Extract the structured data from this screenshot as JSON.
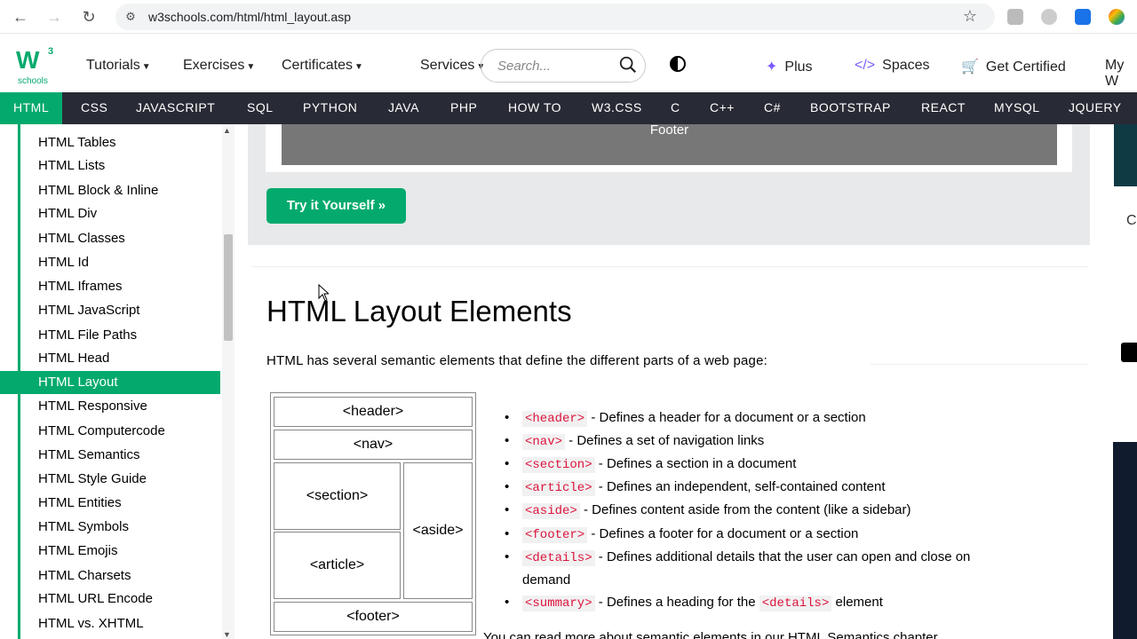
{
  "browser": {
    "url": "w3schools.com/html/html_layout.asp"
  },
  "topnav": {
    "logo_sup": "3",
    "logo_text": "schools",
    "menus": [
      "Tutorials",
      "Exercises",
      "Certificates",
      "Services"
    ],
    "search_placeholder": "Search...",
    "plus": "Plus",
    "spaces": "Spaces",
    "get_certified": "Get Certified",
    "my": "My W"
  },
  "subjects": [
    "HTML",
    "CSS",
    "JAVASCRIPT",
    "SQL",
    "PYTHON",
    "JAVA",
    "PHP",
    "HOW TO",
    "W3.CSS",
    "C",
    "C++",
    "C#",
    "BOOTSTRAP",
    "REACT",
    "MYSQL",
    "JQUERY"
  ],
  "sidebar": {
    "items": [
      "HTML Tables",
      "HTML Lists",
      "HTML Block & Inline",
      "HTML Div",
      "HTML Classes",
      "HTML Id",
      "HTML Iframes",
      "HTML JavaScript",
      "HTML File Paths",
      "HTML Head",
      "HTML Layout",
      "HTML Responsive",
      "HTML Computercode",
      "HTML Semantics",
      "HTML Style Guide",
      "HTML Entities",
      "HTML Symbols",
      "HTML Emojis",
      "HTML Charsets",
      "HTML URL Encode",
      "HTML vs. XHTML"
    ],
    "active": "HTML Layout"
  },
  "main": {
    "footer_demo": "Footer",
    "try_button": "Try it Yourself »",
    "heading": "HTML Layout Elements",
    "intro": "HTML has several semantic elements that define the different parts of a web page:",
    "diagram": {
      "header": "<header>",
      "nav": "<nav>",
      "section": "<section>",
      "article": "<article>",
      "aside": "<aside>",
      "footer": "<footer>"
    },
    "elements": [
      {
        "tag": "<header>",
        "desc": " - Defines a header for a document or a section"
      },
      {
        "tag": "<nav>",
        "desc": " - Defines a set of navigation links"
      },
      {
        "tag": "<section>",
        "desc": " - Defines a section in a document"
      },
      {
        "tag": "<article>",
        "desc": " - Defines an independent, self-contained content"
      },
      {
        "tag": "<aside>",
        "desc": " - Defines content aside from the content (like a sidebar)"
      },
      {
        "tag": "<footer>",
        "desc": " - Defines a footer for a document or a section"
      },
      {
        "tag": "<details>",
        "desc": " - Defines additional details that the user can open and close on",
        "cont": "demand"
      },
      {
        "tag": "<summary>",
        "desc": " - Defines a heading for the ",
        "tag2": "<details>",
        "desc2": " element"
      }
    ],
    "bottom_note": "You can read more about semantic elements in our HTML Semantics chapter."
  },
  "side_letter": "C",
  "colors": {
    "brand_green": "#04aa6d",
    "subject_bar": "#282a35",
    "code_red": "#dc143c"
  }
}
